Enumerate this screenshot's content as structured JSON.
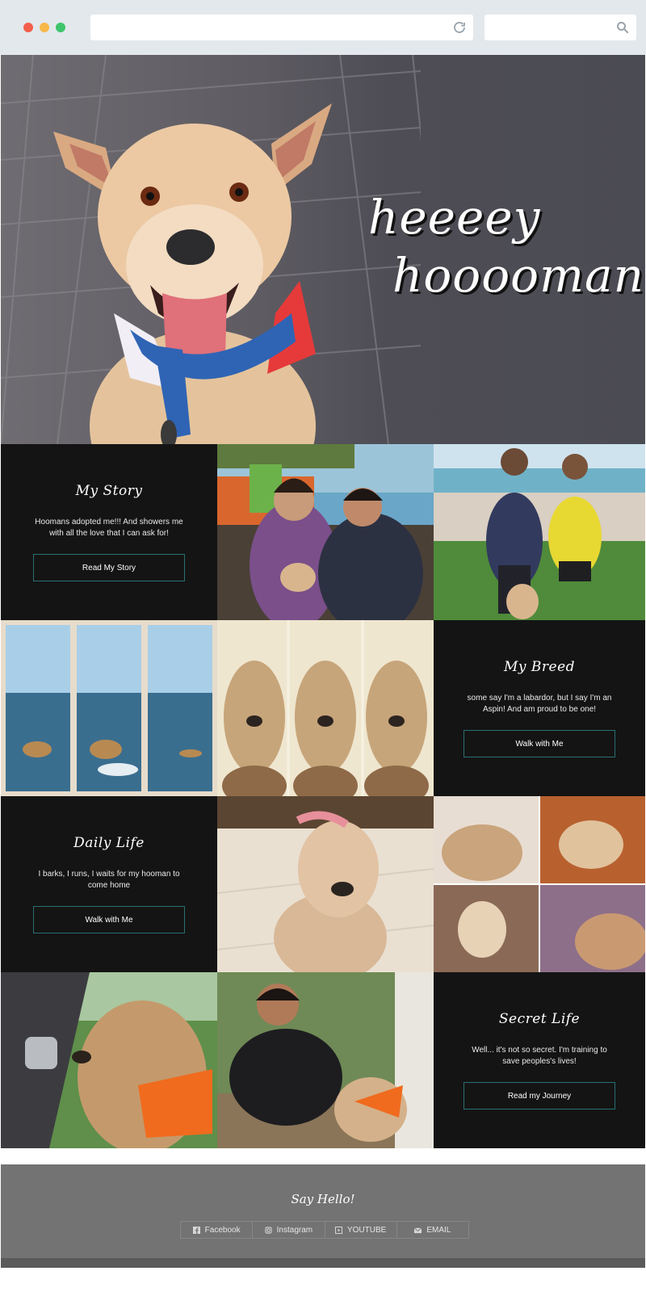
{
  "hero": {
    "line1": "heeeey",
    "line2": "hooooman!"
  },
  "panels": {
    "story": {
      "title": "My Story",
      "text": "Hoomans adopted me!!! And showers me with all the love that I can ask for!",
      "button": "Read My Story"
    },
    "breed": {
      "title": "My Breed",
      "text": "some say I'm a labardor, but I say I'm an Aspin! And am proud to be one!",
      "button": "Walk with Me"
    },
    "daily": {
      "title": "Daily Life",
      "text": "I barks, I runs, I waits for my hooman to come home",
      "button": "Walk with Me"
    },
    "secret": {
      "title": "Secret Life",
      "text": "Well... it's not so secret. I'm training to save peoples's lives!",
      "button": "Read my Journey"
    }
  },
  "footer": {
    "title": "Say Hello!",
    "links": [
      {
        "label": "Facebook",
        "icon": "facebook-icon"
      },
      {
        "label": "Instagram",
        "icon": "instagram-icon"
      },
      {
        "label": "YOUTUBE",
        "icon": "youtube-icon"
      },
      {
        "label": "EMAIL",
        "icon": "email-icon"
      }
    ]
  },
  "colors": {
    "panel_bg": "#141414",
    "button_border": "#2a6f72",
    "footer_bg": "#737373"
  }
}
